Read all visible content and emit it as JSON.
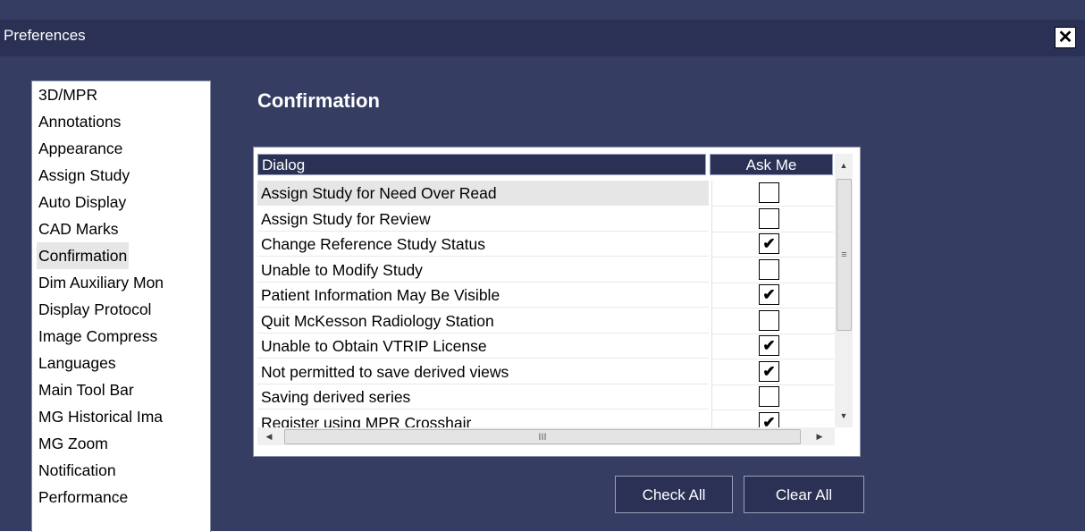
{
  "window": {
    "title": "Preferences",
    "close_glyph": "✕"
  },
  "sidebar": {
    "items": [
      {
        "label": "3D/MPR",
        "selected": false
      },
      {
        "label": "Annotations",
        "selected": false
      },
      {
        "label": "Appearance",
        "selected": false
      },
      {
        "label": "Assign Study",
        "selected": false
      },
      {
        "label": "Auto Display",
        "selected": false
      },
      {
        "label": "CAD Marks",
        "selected": false
      },
      {
        "label": "Confirmation",
        "selected": true
      },
      {
        "label": "Dim Auxiliary Mon",
        "selected": false
      },
      {
        "label": "Display Protocol",
        "selected": false
      },
      {
        "label": "Image Compress",
        "selected": false
      },
      {
        "label": "Languages",
        "selected": false
      },
      {
        "label": "Main Tool Bar",
        "selected": false
      },
      {
        "label": "MG Historical Ima",
        "selected": false
      },
      {
        "label": "MG Zoom",
        "selected": false
      },
      {
        "label": "Notification",
        "selected": false
      },
      {
        "label": "Performance",
        "selected": false
      }
    ]
  },
  "main": {
    "section_title": "Confirmation",
    "table": {
      "columns": [
        "Dialog",
        "Ask Me"
      ],
      "rows": [
        {
          "dialog": "Assign Study for Need Over Read",
          "ask_me": false,
          "selected": true
        },
        {
          "dialog": "Assign Study for Review",
          "ask_me": false,
          "selected": false
        },
        {
          "dialog": "Change Reference Study Status",
          "ask_me": true,
          "selected": false
        },
        {
          "dialog": "Unable to Modify Study",
          "ask_me": false,
          "selected": false
        },
        {
          "dialog": "Patient Information May Be Visible",
          "ask_me": true,
          "selected": false
        },
        {
          "dialog": "Quit McKesson Radiology Station",
          "ask_me": false,
          "selected": false
        },
        {
          "dialog": "Unable to Obtain VTRIP License",
          "ask_me": true,
          "selected": false
        },
        {
          "dialog": "Not permitted to save derived views",
          "ask_me": true,
          "selected": false
        },
        {
          "dialog": "Saving derived series",
          "ask_me": false,
          "selected": false
        },
        {
          "dialog": "Register using MPR Crosshair",
          "ask_me": true,
          "selected": false
        }
      ]
    },
    "check_mark_glyph": "✔",
    "buttons": {
      "check_all": "Check All",
      "clear_all": "Clear All"
    }
  },
  "icons": {
    "scroll_up": "▲",
    "scroll_down": "▼",
    "scroll_left": "◀",
    "scroll_right": "▶",
    "thumb_grip_v": "≡",
    "thumb_grip_h": "III"
  },
  "colors": {
    "background": "#353d62",
    "title_strip": "#2a3154",
    "selection": "#e6e6e6"
  }
}
